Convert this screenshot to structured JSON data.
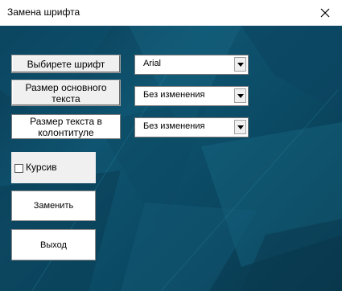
{
  "window": {
    "title": "Замена шрифта"
  },
  "labels": {
    "font": "Выбирете шрифт",
    "main_size": "Размер основного текста",
    "footer_size": "Размер текста в колонтитуле"
  },
  "combos": {
    "font_value": "Arial",
    "main_size_value": "Без изменения",
    "footer_size_value": "Без изменения"
  },
  "checkbox": {
    "label": "Курсив",
    "checked": false
  },
  "buttons": {
    "replace": "Заменить",
    "exit": "Выход"
  },
  "colors": {
    "background": "#0f5470",
    "panel": "#f0f0f0"
  }
}
